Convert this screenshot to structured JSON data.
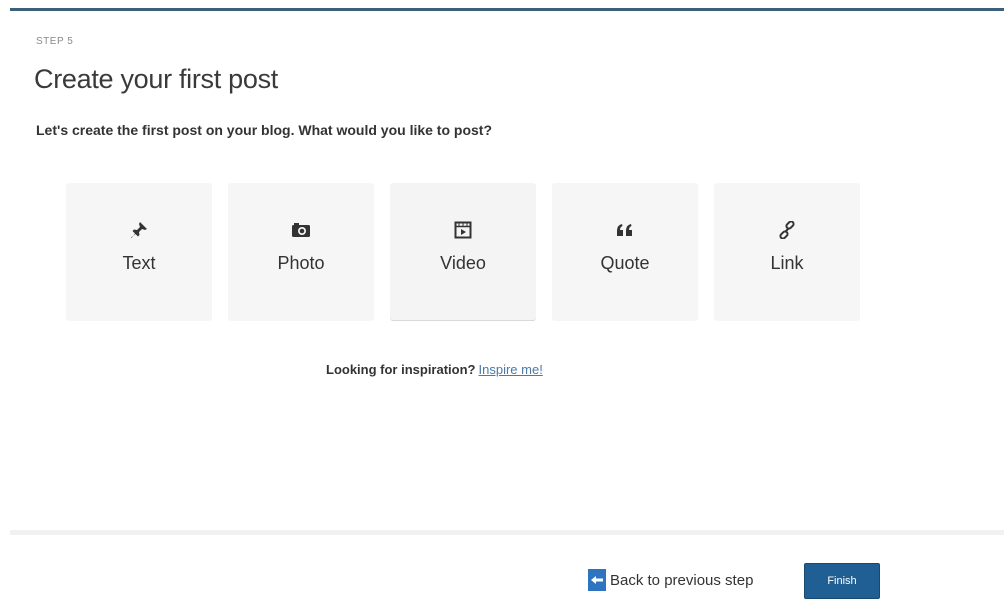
{
  "step": {
    "label": "STEP 5"
  },
  "title": "Create your first post",
  "intro": "Let's create the first post on your blog. What would you like to post?",
  "options": [
    {
      "label": "Text",
      "icon": "pin-icon"
    },
    {
      "label": "Photo",
      "icon": "camera-icon"
    },
    {
      "label": "Video",
      "icon": "video-icon"
    },
    {
      "label": "Quote",
      "icon": "quote-icon"
    },
    {
      "label": "Link",
      "icon": "link-icon"
    }
  ],
  "inspiration": {
    "prompt": "Looking for inspiration?",
    "link": "Inspire me!"
  },
  "footer": {
    "back_label": "Back to previous step",
    "finish_label": "Finish"
  },
  "colors": {
    "accent": "#1f5f93",
    "top_bar": "#3c6079",
    "link": "#4a7aa8"
  }
}
